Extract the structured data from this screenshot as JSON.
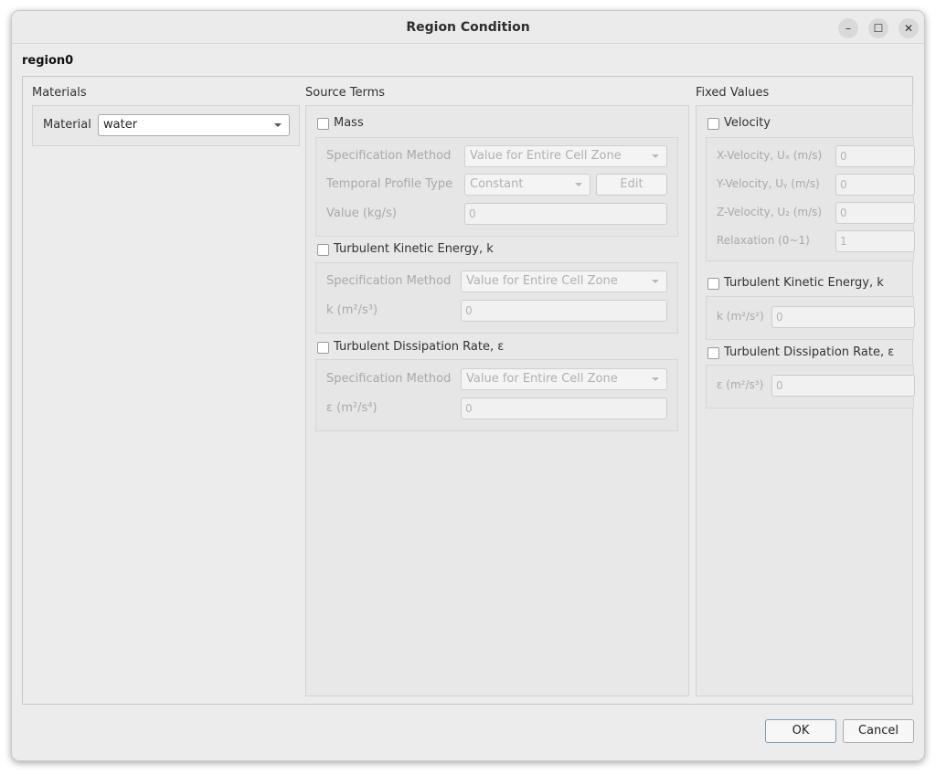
{
  "window": {
    "title": "Region Condition",
    "minimize_glyph": "–",
    "maximize_glyph": "☐",
    "close_glyph": "✕"
  },
  "region_name": "region0",
  "materials": {
    "title": "Materials",
    "material_label": "Material",
    "material_value": "water"
  },
  "source_terms": {
    "title": "Source Terms",
    "mass": {
      "label": "Mass",
      "spec_method_label": "Specification Method",
      "spec_method_value": "Value for Entire Cell Zone",
      "temporal_label": "Temporal Profile Type",
      "temporal_value": "Constant",
      "edit_label": "Edit",
      "value_label": "Value (kg/s)",
      "value": "0"
    },
    "tke": {
      "label": "Turbulent Kinetic Energy, k",
      "spec_method_label": "Specification Method",
      "spec_method_value": "Value for Entire Cell Zone",
      "k_label": "k (m²/s³)",
      "k_value": "0"
    },
    "tdr": {
      "label": "Turbulent Dissipation Rate, ε",
      "spec_method_label": "Specification Method",
      "spec_method_value": "Value for Entire Cell Zone",
      "eps_label": "ε (m²/s⁴)",
      "eps_value": "0"
    }
  },
  "fixed_values": {
    "title": "Fixed Values",
    "velocity": {
      "label": "Velocity",
      "x_label": "X-Velocity, Uₓ (m/s)",
      "x_value": "0",
      "y_label": "Y-Velocity, Uᵧ (m/s)",
      "y_value": "0",
      "z_label": "Z-Velocity, U₂ (m/s)",
      "z_value": "0",
      "relax_label": "Relaxation (0~1)",
      "relax_value": "1"
    },
    "tke": {
      "label": "Turbulent Kinetic Energy, k",
      "k_label": "k (m²/s²)",
      "k_value": "0"
    },
    "tdr": {
      "label": "Turbulent Dissipation Rate, ε",
      "eps_label": "ε (m²/s³)",
      "eps_value": "0"
    }
  },
  "buttons": {
    "ok": "OK",
    "cancel": "Cancel"
  }
}
